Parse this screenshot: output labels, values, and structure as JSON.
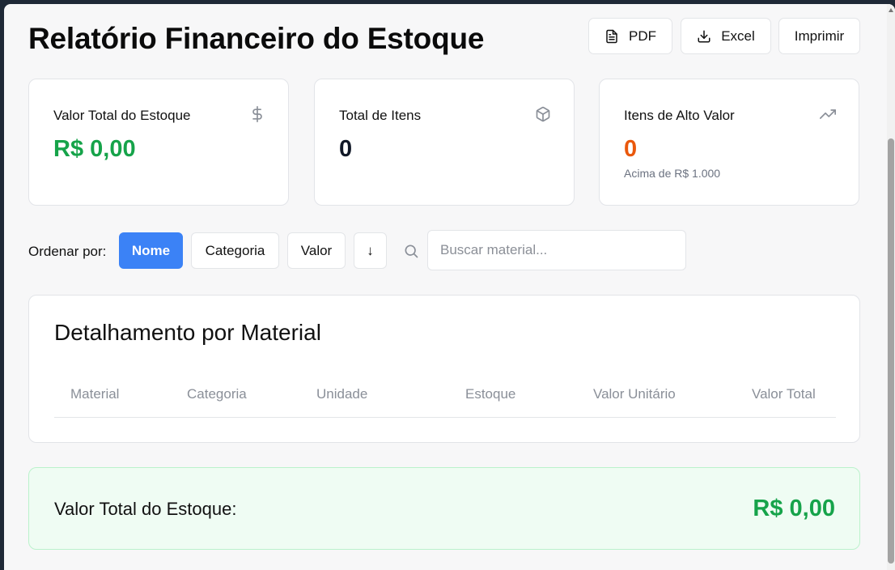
{
  "header": {
    "title": "Relatório Financeiro do Estoque"
  },
  "actions": {
    "pdf": "PDF",
    "excel": "Excel",
    "print": "Imprimir"
  },
  "cards": [
    {
      "label": "Valor Total do Estoque",
      "value": "R$ 0,00",
      "icon": "dollar-icon",
      "color": "#16a34a"
    },
    {
      "label": "Total de Itens",
      "value": "0",
      "icon": "package-icon"
    },
    {
      "label": "Itens de Alto Valor",
      "value": "0",
      "sub": "Acima de R$ 1.000",
      "icon": "trending-up-icon",
      "color": "#ea580c"
    }
  ],
  "sort": {
    "label": "Ordenar por:",
    "options": [
      "Nome",
      "Categoria",
      "Valor"
    ],
    "active": "Nome",
    "direction": "↓"
  },
  "search": {
    "placeholder": "Buscar material..."
  },
  "table": {
    "title": "Detalhamento por Material",
    "columns": [
      "Material",
      "Categoria",
      "Unidade",
      "Estoque",
      "Valor Unitário",
      "Valor Total"
    ]
  },
  "total": {
    "label": "Valor Total do Estoque:",
    "value": "R$ 0,00"
  },
  "colors": {
    "accent": "#3b82f6",
    "green": "#16a34a",
    "orange": "#ea580c"
  }
}
